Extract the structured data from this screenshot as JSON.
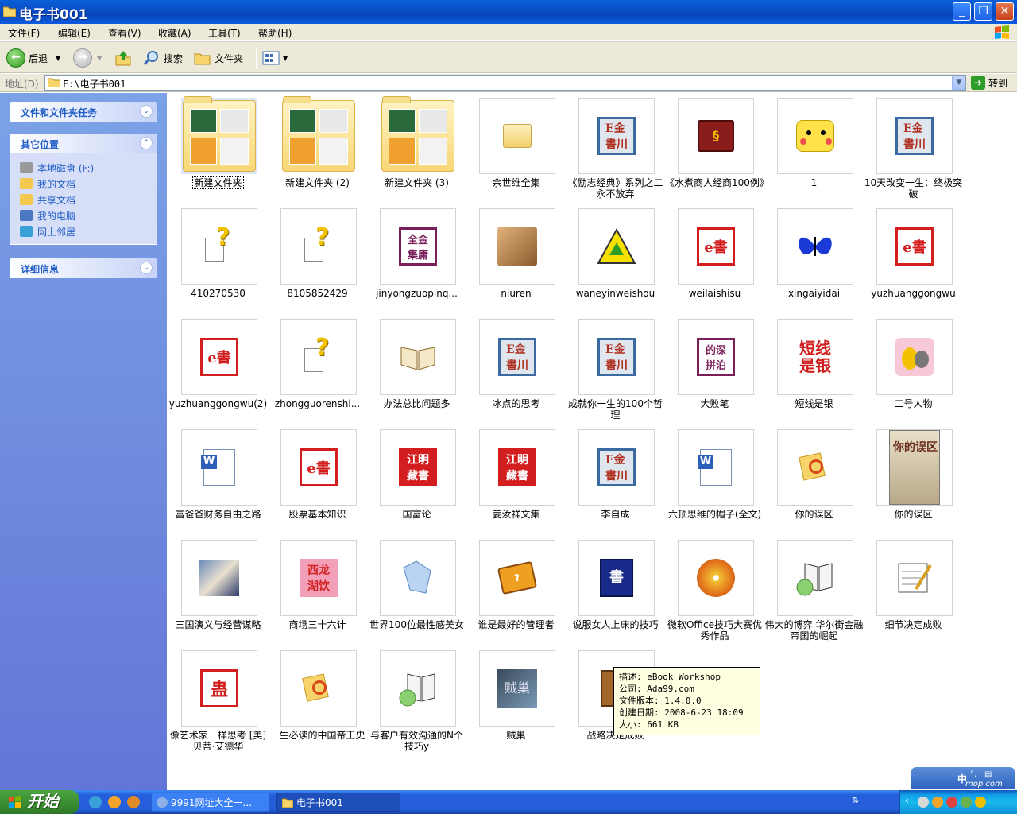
{
  "window": {
    "title": "电子书001",
    "controls": [
      "minimize",
      "maximize",
      "close"
    ]
  },
  "menu": [
    {
      "label": "文件(F)"
    },
    {
      "label": "编辑(E)"
    },
    {
      "label": "查看(V)"
    },
    {
      "label": "收藏(A)"
    },
    {
      "label": "工具(T)"
    },
    {
      "label": "帮助(H)"
    }
  ],
  "toolbar": {
    "back_label": "后退",
    "search_label": "搜索",
    "folders_label": "文件夹"
  },
  "address": {
    "label": "地址(D)",
    "value": "F:\\电子书001",
    "go_label": "转到"
  },
  "left_panel": {
    "tasks_title": "文件和文件夹任务",
    "places_title": "其它位置",
    "places": [
      {
        "label": "本地磁盘 (F:)",
        "icon": "drive-icon",
        "color": "#9a9a9a"
      },
      {
        "label": "我的文档",
        "icon": "my-documents-icon",
        "color": "#f2c94c"
      },
      {
        "label": "共享文档",
        "icon": "shared-documents-icon",
        "color": "#f2c94c"
      },
      {
        "label": "我的电脑",
        "icon": "my-computer-icon",
        "color": "#4a78c2"
      },
      {
        "label": "网上邻居",
        "icon": "network-icon",
        "color": "#3aa0d8"
      }
    ],
    "details_title": "详细信息"
  },
  "files": [
    {
      "label": "新建文件夹",
      "icon": "folder-icon",
      "selected": true
    },
    {
      "label": "新建文件夹 (2)",
      "icon": "folder-icon"
    },
    {
      "label": "新建文件夹 (3)",
      "icon": "folder-icon"
    },
    {
      "label": "余世维全集",
      "icon": "folder-icon"
    },
    {
      "label": "《励志经典》系列之二永不放弃",
      "icon": "ebook-seal-icon"
    },
    {
      "label": "《水煮商人经商100例》",
      "icon": "book-icon"
    },
    {
      "label": "1",
      "icon": "pikachu-icon"
    },
    {
      "label": "10天改变一生：终极突破",
      "icon": "ebook-seal-icon"
    },
    {
      "label": "410270530",
      "icon": "unknown-file-icon"
    },
    {
      "label": "8105852429",
      "icon": "unknown-file-icon"
    },
    {
      "label": "jinyongzuopinq...",
      "icon": "jinyong-seal-icon"
    },
    {
      "label": "niuren",
      "icon": "portrait-icon"
    },
    {
      "label": "waneyinweishou",
      "icon": "warning-triangle-icon"
    },
    {
      "label": "weilaishisu",
      "icon": "ebook-e-icon"
    },
    {
      "label": "xingaiyidai",
      "icon": "butterfly-icon"
    },
    {
      "label": "yuzhuanggongwu",
      "icon": "ebook-e-icon"
    },
    {
      "label": "yuzhuanggongwu(2)",
      "icon": "ebook-e-icon"
    },
    {
      "label": "zhongguorenshi...",
      "icon": "unknown-file-icon"
    },
    {
      "label": "办法总比问题多",
      "icon": "open-book-icon"
    },
    {
      "label": "冰点的思考",
      "icon": "ebook-seal-icon"
    },
    {
      "label": "成就你一生的100个哲理",
      "icon": "ebook-seal-icon"
    },
    {
      "label": "大败笔",
      "icon": "purple-seal-icon"
    },
    {
      "label": "短线是银",
      "icon": "red-text-icon"
    },
    {
      "label": "二号人物",
      "icon": "cartoon-icon"
    },
    {
      "label": "富爸爸财务自由之路",
      "icon": "word-doc-icon"
    },
    {
      "label": "股票基本知识",
      "icon": "ebook-e-icon"
    },
    {
      "label": "国富论",
      "icon": "red-seal-icon"
    },
    {
      "label": "姜汝祥文集",
      "icon": "red-seal-icon"
    },
    {
      "label": "李自成",
      "icon": "ebook-seal-icon"
    },
    {
      "label": "六顶思维的帽子(全文)",
      "icon": "word-doc-icon"
    },
    {
      "label": "你的误区",
      "icon": "magnifier-doc-icon"
    },
    {
      "label": "你的误区",
      "icon": "book-cover-icon"
    },
    {
      "label": "三国演义与经营谋略",
      "icon": "photo-icon"
    },
    {
      "label": "商场三十六计",
      "icon": "pink-seal-icon"
    },
    {
      "label": "世界100位最性感美女",
      "icon": "crystal-icon"
    },
    {
      "label": "谁是最好的管理者",
      "icon": "help-book-icon"
    },
    {
      "label": "说服女人上床的技巧",
      "icon": "blue-book-icon"
    },
    {
      "label": "微软Office技巧大赛优秀作品",
      "icon": "cd-icon"
    },
    {
      "label": "伟大的博弈 华尔街金融帝国的崛起",
      "icon": "book-cd-icon"
    },
    {
      "label": "细节决定成败",
      "icon": "notepad-icon"
    },
    {
      "label": "像艺术家一样思考 [美]贝蒂·艾德华",
      "icon": "red-symbol-icon"
    },
    {
      "label": "一生必读的中国帝王史",
      "icon": "magnifier-doc-icon"
    },
    {
      "label": "与客户有效沟通的N个技巧y",
      "icon": "book-cd-icon"
    },
    {
      "label": "贼巢",
      "icon": "dark-cover-icon"
    },
    {
      "label": "战略决定成败",
      "icon": "brown-book-icon"
    }
  ],
  "tooltip": {
    "lines": [
      "描述: eBook Workshop",
      "公司: Ada99.com",
      "文件版本: 1.4.0.0",
      "创建日期: 2008-6-23 18:09",
      "大小: 661 KB"
    ]
  },
  "taskbar": {
    "start_label": "开始",
    "tasks": [
      {
        "label": "9991网址大全一..."
      },
      {
        "label": "电子书001"
      }
    ]
  },
  "ime": {
    "mode_label": "中"
  },
  "watermark": "mop.com"
}
